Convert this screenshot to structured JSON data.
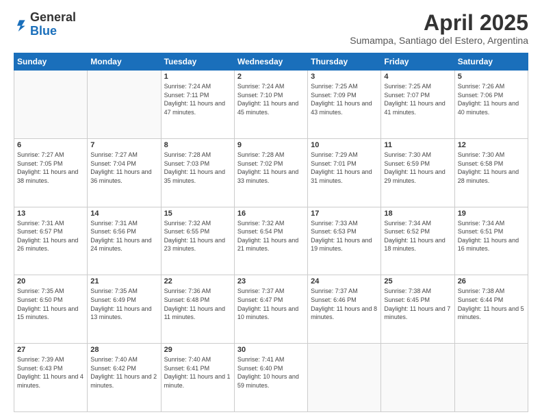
{
  "header": {
    "logo_general": "General",
    "logo_blue": "Blue",
    "main_title": "April 2025",
    "subtitle": "Sumampa, Santiago del Estero, Argentina"
  },
  "weekdays": [
    "Sunday",
    "Monday",
    "Tuesday",
    "Wednesday",
    "Thursday",
    "Friday",
    "Saturday"
  ],
  "weeks": [
    [
      {
        "day": "",
        "info": ""
      },
      {
        "day": "",
        "info": ""
      },
      {
        "day": "1",
        "info": "Sunrise: 7:24 AM\nSunset: 7:11 PM\nDaylight: 11 hours and 47 minutes."
      },
      {
        "day": "2",
        "info": "Sunrise: 7:24 AM\nSunset: 7:10 PM\nDaylight: 11 hours and 45 minutes."
      },
      {
        "day": "3",
        "info": "Sunrise: 7:25 AM\nSunset: 7:09 PM\nDaylight: 11 hours and 43 minutes."
      },
      {
        "day": "4",
        "info": "Sunrise: 7:25 AM\nSunset: 7:07 PM\nDaylight: 11 hours and 41 minutes."
      },
      {
        "day": "5",
        "info": "Sunrise: 7:26 AM\nSunset: 7:06 PM\nDaylight: 11 hours and 40 minutes."
      }
    ],
    [
      {
        "day": "6",
        "info": "Sunrise: 7:27 AM\nSunset: 7:05 PM\nDaylight: 11 hours and 38 minutes."
      },
      {
        "day": "7",
        "info": "Sunrise: 7:27 AM\nSunset: 7:04 PM\nDaylight: 11 hours and 36 minutes."
      },
      {
        "day": "8",
        "info": "Sunrise: 7:28 AM\nSunset: 7:03 PM\nDaylight: 11 hours and 35 minutes."
      },
      {
        "day": "9",
        "info": "Sunrise: 7:28 AM\nSunset: 7:02 PM\nDaylight: 11 hours and 33 minutes."
      },
      {
        "day": "10",
        "info": "Sunrise: 7:29 AM\nSunset: 7:01 PM\nDaylight: 11 hours and 31 minutes."
      },
      {
        "day": "11",
        "info": "Sunrise: 7:30 AM\nSunset: 6:59 PM\nDaylight: 11 hours and 29 minutes."
      },
      {
        "day": "12",
        "info": "Sunrise: 7:30 AM\nSunset: 6:58 PM\nDaylight: 11 hours and 28 minutes."
      }
    ],
    [
      {
        "day": "13",
        "info": "Sunrise: 7:31 AM\nSunset: 6:57 PM\nDaylight: 11 hours and 26 minutes."
      },
      {
        "day": "14",
        "info": "Sunrise: 7:31 AM\nSunset: 6:56 PM\nDaylight: 11 hours and 24 minutes."
      },
      {
        "day": "15",
        "info": "Sunrise: 7:32 AM\nSunset: 6:55 PM\nDaylight: 11 hours and 23 minutes."
      },
      {
        "day": "16",
        "info": "Sunrise: 7:32 AM\nSunset: 6:54 PM\nDaylight: 11 hours and 21 minutes."
      },
      {
        "day": "17",
        "info": "Sunrise: 7:33 AM\nSunset: 6:53 PM\nDaylight: 11 hours and 19 minutes."
      },
      {
        "day": "18",
        "info": "Sunrise: 7:34 AM\nSunset: 6:52 PM\nDaylight: 11 hours and 18 minutes."
      },
      {
        "day": "19",
        "info": "Sunrise: 7:34 AM\nSunset: 6:51 PM\nDaylight: 11 hours and 16 minutes."
      }
    ],
    [
      {
        "day": "20",
        "info": "Sunrise: 7:35 AM\nSunset: 6:50 PM\nDaylight: 11 hours and 15 minutes."
      },
      {
        "day": "21",
        "info": "Sunrise: 7:35 AM\nSunset: 6:49 PM\nDaylight: 11 hours and 13 minutes."
      },
      {
        "day": "22",
        "info": "Sunrise: 7:36 AM\nSunset: 6:48 PM\nDaylight: 11 hours and 11 minutes."
      },
      {
        "day": "23",
        "info": "Sunrise: 7:37 AM\nSunset: 6:47 PM\nDaylight: 11 hours and 10 minutes."
      },
      {
        "day": "24",
        "info": "Sunrise: 7:37 AM\nSunset: 6:46 PM\nDaylight: 11 hours and 8 minutes."
      },
      {
        "day": "25",
        "info": "Sunrise: 7:38 AM\nSunset: 6:45 PM\nDaylight: 11 hours and 7 minutes."
      },
      {
        "day": "26",
        "info": "Sunrise: 7:38 AM\nSunset: 6:44 PM\nDaylight: 11 hours and 5 minutes."
      }
    ],
    [
      {
        "day": "27",
        "info": "Sunrise: 7:39 AM\nSunset: 6:43 PM\nDaylight: 11 hours and 4 minutes."
      },
      {
        "day": "28",
        "info": "Sunrise: 7:40 AM\nSunset: 6:42 PM\nDaylight: 11 hours and 2 minutes."
      },
      {
        "day": "29",
        "info": "Sunrise: 7:40 AM\nSunset: 6:41 PM\nDaylight: 11 hours and 1 minute."
      },
      {
        "day": "30",
        "info": "Sunrise: 7:41 AM\nSunset: 6:40 PM\nDaylight: 10 hours and 59 minutes."
      },
      {
        "day": "",
        "info": ""
      },
      {
        "day": "",
        "info": ""
      },
      {
        "day": "",
        "info": ""
      }
    ]
  ]
}
